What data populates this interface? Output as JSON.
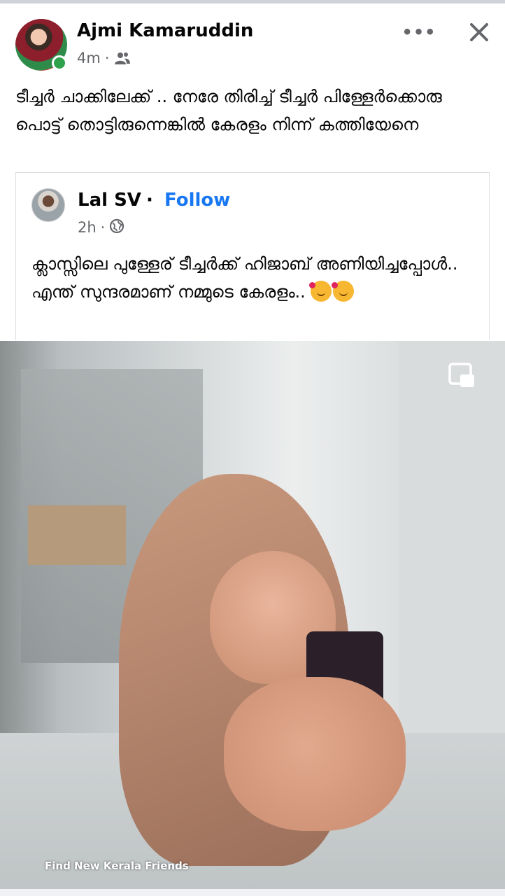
{
  "post": {
    "author": "Ajmi Kamaruddin",
    "time": "4m",
    "separator": "·",
    "audience_icon": "friends-icon",
    "text": "ടീച്ചർ ചാക്കിലേക്ക് .. നേരേ തിരിച്ച് ടീച്ചർ പിള്ളേർക്കൊരു പൊട്ട് തൊട്ടിരുന്നെങ്കിൽ കേരളം നിന്ന് കത്തിയേനെ",
    "more_icon": "•••"
  },
  "shared": {
    "author": "Lal SV",
    "dot": "·",
    "follow_label": "Follow",
    "time": "2h",
    "separator": "·",
    "audience_icon": "globe-icon",
    "text": "ക്ലാസ്സിലെ പുള്ളേര് ടീച്ചർക്ക് ഹിജാബ് അണിയിച്ചപ്പോൾ.. എന്ത് സുന്ദരമാണ് നമ്മുടെ കേരളം.."
  },
  "video": {
    "watermark": "Find New Kerala Friends"
  },
  "colors": {
    "link": "#1877f2",
    "secondary_text": "#65676b",
    "online": "#31a24c"
  }
}
